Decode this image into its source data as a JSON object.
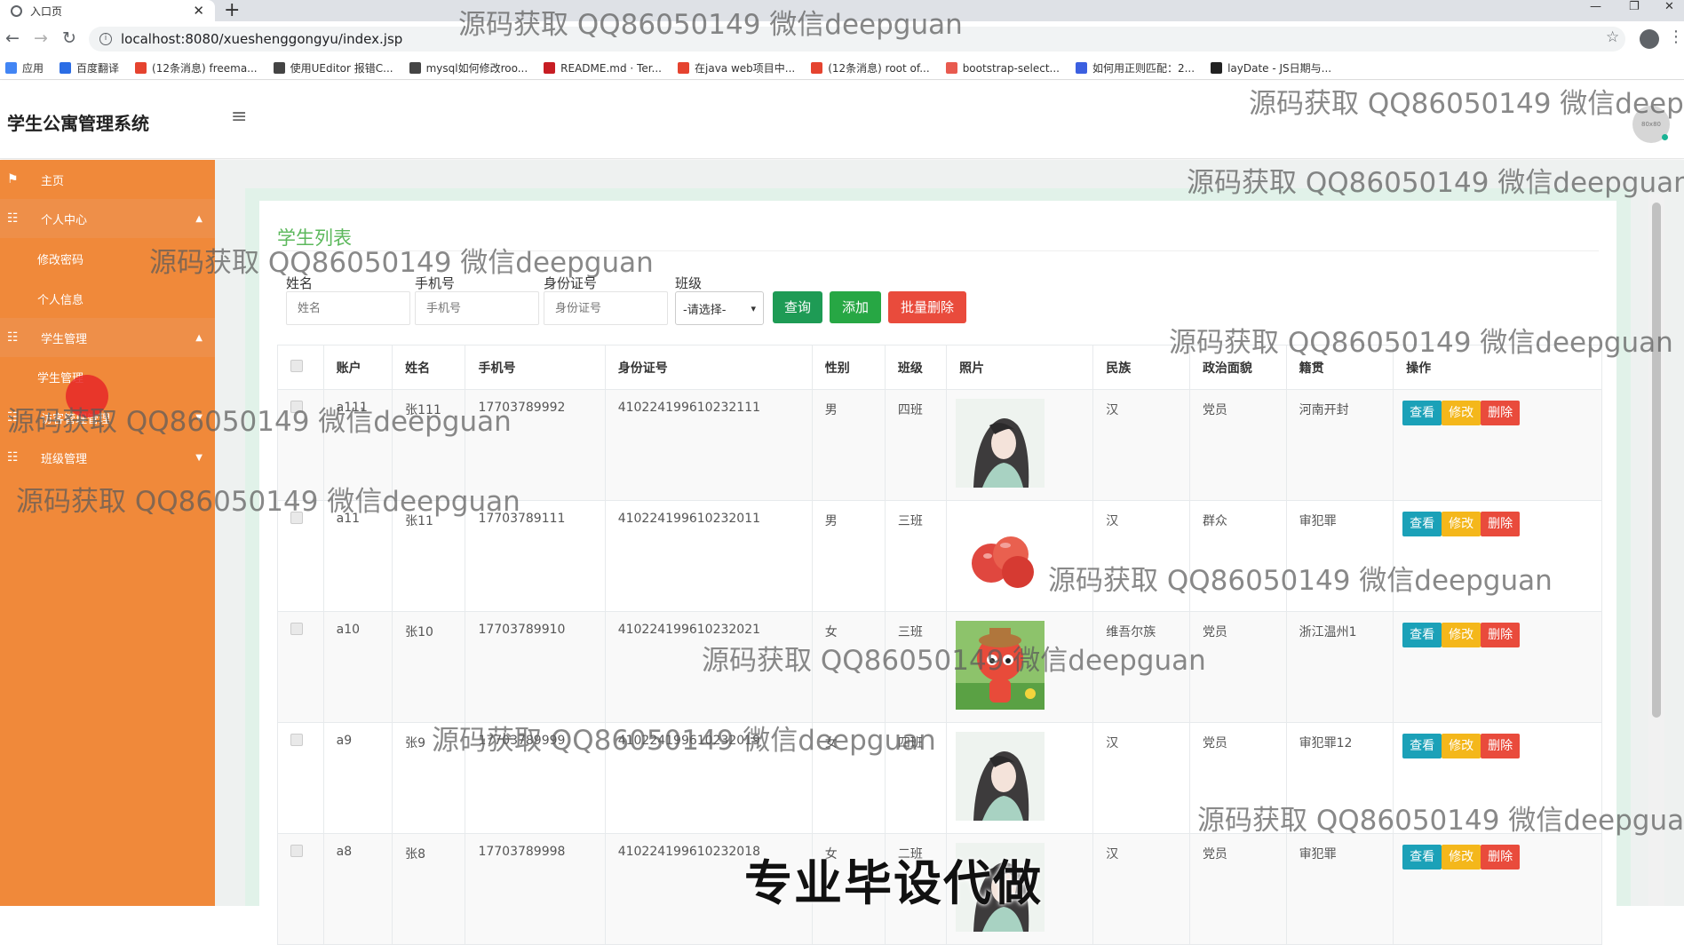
{
  "browser": {
    "tab_title": "入口页",
    "tab_close": "✕",
    "new_tab": "+",
    "url": "localhost:8080/xueshenggongyu/index.jsp",
    "bookmarks": [
      {
        "label": "应用",
        "color": "#4285f4"
      },
      {
        "label": "百度翻译",
        "color": "#2b6de5"
      },
      {
        "label": "(12条消息) freema...",
        "color": "#e5432f"
      },
      {
        "label": "使用UEditor 报错C...",
        "color": "#444444"
      },
      {
        "label": "mysql如何修改roo...",
        "color": "#444444"
      },
      {
        "label": "README.md · Ter...",
        "color": "#c71d23"
      },
      {
        "label": "在java web项目中...",
        "color": "#e5432f"
      },
      {
        "label": "(12条消息) root of...",
        "color": "#e5432f"
      },
      {
        "label": "bootstrap-select...",
        "color": "#e85a4f"
      },
      {
        "label": "如何用正则匹配：2...",
        "color": "#3b5fe0"
      },
      {
        "label": "layDate - JS日期与...",
        "color": "#222222"
      }
    ]
  },
  "header": {
    "brand": "学生公寓管理系统",
    "avatar_text": "80x80"
  },
  "sidebar": {
    "items": [
      {
        "label": "主页",
        "icon": "flag-icon",
        "type": "top"
      },
      {
        "label": "个人中心",
        "icon": "grid-icon",
        "type": "group",
        "caret": "▲"
      },
      {
        "label": "修改密码",
        "type": "sub"
      },
      {
        "label": "个人信息",
        "type": "sub"
      },
      {
        "label": "学生管理",
        "icon": "grid-icon",
        "type": "group",
        "caret": "▲"
      },
      {
        "label": "学生管理",
        "type": "sub"
      },
      {
        "label": "访客管理管理",
        "icon": "grid-icon",
        "type": "top",
        "caret": "▼"
      },
      {
        "label": "班级管理",
        "icon": "grid-icon",
        "type": "top",
        "caret": "▼"
      }
    ]
  },
  "page": {
    "title": "学生列表",
    "filters": {
      "name": {
        "label": "姓名",
        "placeholder": "姓名"
      },
      "phone": {
        "label": "手机号",
        "placeholder": "手机号"
      },
      "idcard": {
        "label": "身份证号",
        "placeholder": "身份证号"
      },
      "class": {
        "label": "班级",
        "selected": "-请选择-"
      }
    },
    "buttons": {
      "search": "查询",
      "add": "添加",
      "batch_delete": "批量删除"
    },
    "table": {
      "headers": [
        "账户",
        "姓名",
        "手机号",
        "身份证号",
        "性别",
        "班级",
        "照片",
        "民族",
        "政治面貌",
        "籍贯",
        "操作"
      ],
      "action_labels": {
        "view": "查看",
        "edit": "修改",
        "delete": "删除"
      },
      "rows": [
        {
          "account": "a111",
          "name": "张111",
          "phone": "17703789992",
          "idcard": "410224199610232111",
          "gender": "男",
          "class": "四班",
          "photo": "girl",
          "ethnicity": "汉",
          "political": "党员",
          "origin": "河南开封"
        },
        {
          "account": "a11",
          "name": "张11",
          "phone": "17703789111",
          "idcard": "410224199610232011",
          "gender": "男",
          "class": "三班",
          "photo": "apples",
          "ethnicity": "汉",
          "political": "群众",
          "origin": "审犯罪"
        },
        {
          "account": "a10",
          "name": "张10",
          "phone": "17703789910",
          "idcard": "410224199610232021",
          "gender": "女",
          "class": "三班",
          "photo": "cartoon",
          "ethnicity": "维吾尔族",
          "political": "党员",
          "origin": "浙江温州1"
        },
        {
          "account": "a9",
          "name": "张9",
          "phone": "17703789999",
          "idcard": "410224199610232019",
          "gender": "女",
          "class": "四班",
          "photo": "girl",
          "ethnicity": "汉",
          "political": "党员",
          "origin": "审犯罪12"
        },
        {
          "account": "a8",
          "name": "张8",
          "phone": "17703789998",
          "idcard": "410224199610232018",
          "gender": "女",
          "class": "二班",
          "photo": "girl",
          "ethnicity": "汉",
          "political": "党员",
          "origin": "审犯罪"
        }
      ]
    }
  },
  "watermark": {
    "text": "源码获取 QQ86050149 微信deepguan",
    "promo": "专业毕设代做"
  },
  "colors": {
    "sidebar": "#f0893a",
    "title_green": "#5cb85c",
    "search_btn": "#1e9b55",
    "add_btn": "#27a744",
    "delete_btn": "#e94b3c",
    "view_btn": "#1ba1b8",
    "edit_btn": "#f4b71b"
  }
}
